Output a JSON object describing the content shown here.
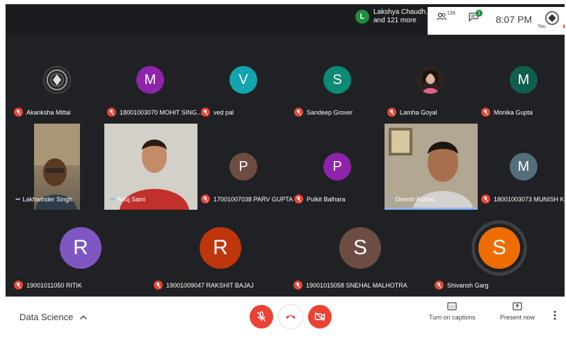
{
  "topbar": {
    "notification": {
      "initial": "L",
      "name": "Lakshya Chaudh...",
      "more": "and 121 more"
    },
    "people_count": "139",
    "chat_badge": "1",
    "time": "8:07 PM",
    "self_label": "You"
  },
  "participants": [
    {
      "name": "Akanksha Mittal",
      "kind": "logo"
    },
    {
      "name": "18001003070 MOHIT SING...",
      "initial": "M",
      "color": "#8e24aa"
    },
    {
      "name": "ved pal",
      "initial": "V",
      "color": "#12a4af"
    },
    {
      "name": "Sandeep Grover",
      "initial": "S",
      "color": "#0b8a75"
    },
    {
      "name": "Lamha Goyal",
      "kind": "photo"
    },
    {
      "name": "Monika Gupta",
      "initial": "M",
      "color": "#0f5e4e"
    },
    {
      "name": "Lakhwinder Singh",
      "kind": "video"
    },
    {
      "name": "Anuj Saini",
      "kind": "video"
    },
    {
      "name": "17001007038 PARV GUPTA",
      "initial": "P",
      "color": "#6d4c41"
    },
    {
      "name": "Pulkit Balhara",
      "initial": "P",
      "color": "#8e24aa"
    },
    {
      "name": "Dinesh Kumar",
      "kind": "video"
    },
    {
      "name": "18001003073 MUNISH KU...",
      "initial": "M",
      "color": "#546e7a"
    },
    {
      "name": "19001011050 RITIK",
      "initial": "R",
      "color": "#7e57c2"
    },
    {
      "name": "19001009047 RAKSHIT BAJAJ",
      "initial": "R",
      "color": "#bf360c"
    },
    {
      "name": "19001015058 SNEHAL MALHOTRA",
      "initial": "S",
      "color": "#6d4c41"
    },
    {
      "name": "Shivansh Garg",
      "initial": "S",
      "color": "#ef6c00"
    }
  ],
  "bottombar": {
    "meeting_title": "Data Science",
    "captions_label": "Turn on captions",
    "present_label": "Present now"
  }
}
